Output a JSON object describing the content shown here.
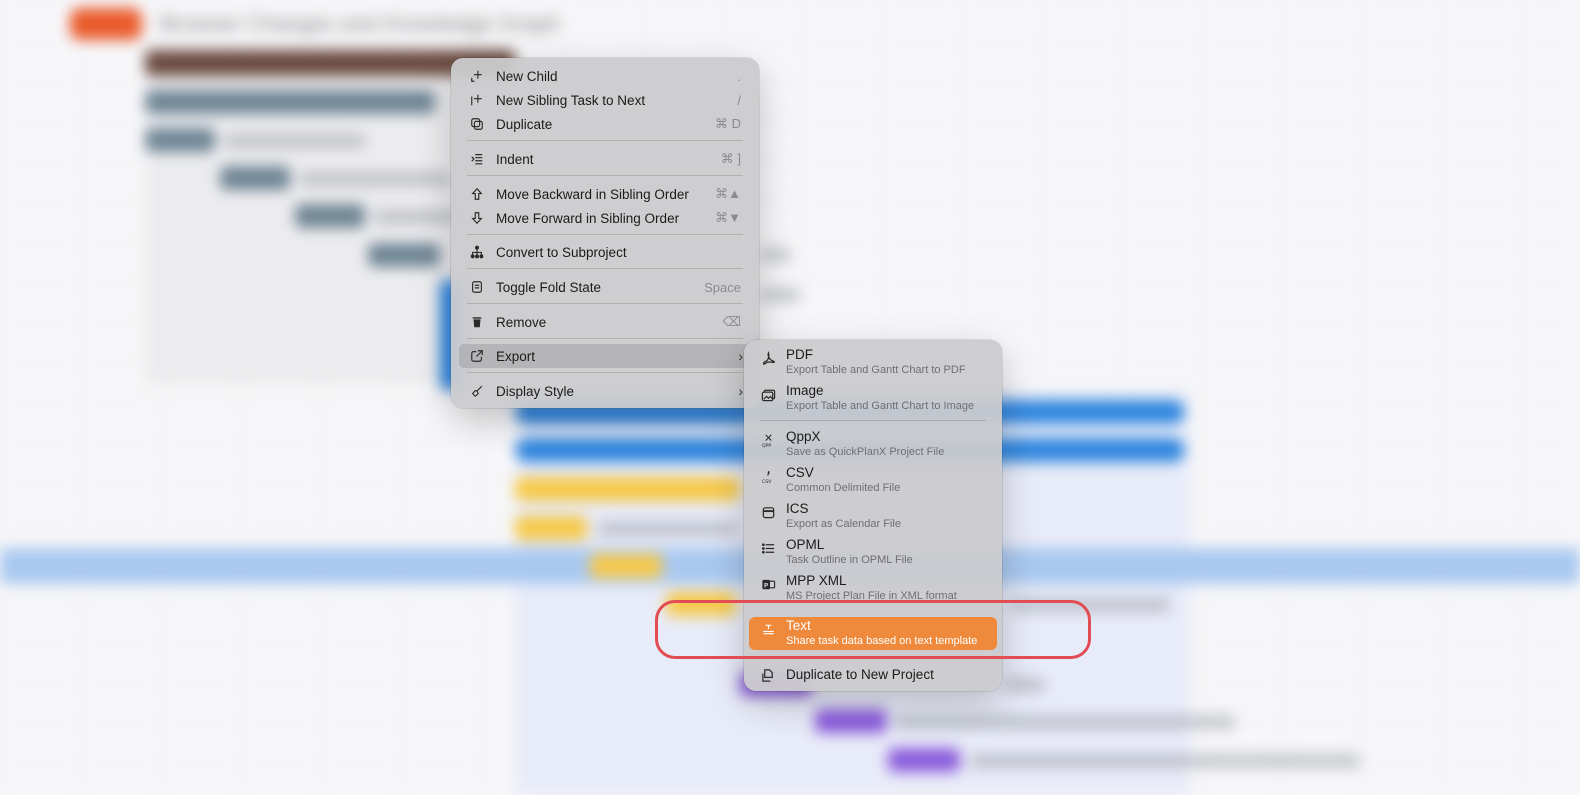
{
  "background": {
    "title": "Browser Changes and Knowledge Graph",
    "accent_colors": {
      "orange": "#ea5b2c",
      "brown": "#6b4a3f",
      "slate": "#6f8595",
      "blue": "#2f86df",
      "yellow": "#f7c948",
      "purple": "#8b5cdd",
      "selection": "#a9c8f0"
    }
  },
  "context_menu": {
    "items": [
      {
        "label": "New Child",
        "shortcut": ".",
        "icon": "new-child-icon"
      },
      {
        "label": "New Sibling Task to Next",
        "shortcut": "/",
        "icon": "new-sibling-icon"
      },
      {
        "label": "Duplicate",
        "shortcut": "⌘ D",
        "icon": "duplicate-icon"
      },
      {
        "label": "Indent",
        "shortcut": "⌘ ]",
        "icon": "indent-icon"
      },
      {
        "label": "Move Backward in Sibling Order",
        "shortcut": "⌘▲",
        "icon": "arrow-up-icon"
      },
      {
        "label": "Move Forward in Sibling Order",
        "shortcut": "⌘▼",
        "icon": "arrow-down-icon"
      },
      {
        "label": "Convert to Subproject",
        "shortcut": "",
        "icon": "hierarchy-icon"
      },
      {
        "label": "Toggle Fold State",
        "shortcut": "Space",
        "icon": "fold-icon"
      },
      {
        "label": "Remove",
        "shortcut": "⌫",
        "icon": "trash-icon"
      },
      {
        "label": "Export",
        "shortcut": "",
        "icon": "export-icon",
        "submenu": true
      },
      {
        "label": "Display Style",
        "shortcut": "",
        "icon": "brush-icon",
        "submenu": true
      }
    ]
  },
  "export_submenu": {
    "items": [
      {
        "title": "PDF",
        "subtitle": "Export Table and Gantt Chart to PDF",
        "icon": "pdf-icon"
      },
      {
        "title": "Image",
        "subtitle": "Export Table and Gantt Chart to Image",
        "icon": "image-icon"
      },
      {
        "title": "QppX",
        "subtitle": "Save as QuickPlanX Project File",
        "icon": "qppx-icon"
      },
      {
        "title": "CSV",
        "subtitle": "Common Delimited File",
        "icon": "csv-icon"
      },
      {
        "title": "ICS",
        "subtitle": "Export as Calendar File",
        "icon": "calendar-icon"
      },
      {
        "title": "OPML",
        "subtitle": "Task Outline in OPML File",
        "icon": "list-icon"
      },
      {
        "title": "MPP XML",
        "subtitle": "MS Project Plan File in XML format",
        "icon": "ms-project-icon"
      },
      {
        "title": "Text",
        "subtitle": "Share task data based on text template",
        "icon": "text-template-icon",
        "selected": true
      },
      {
        "title": "Duplicate to New Project",
        "subtitle": "",
        "icon": "duplicate-project-icon"
      }
    ]
  },
  "highlight_color": "#e24d54",
  "selection_color": "#ef8a3d"
}
